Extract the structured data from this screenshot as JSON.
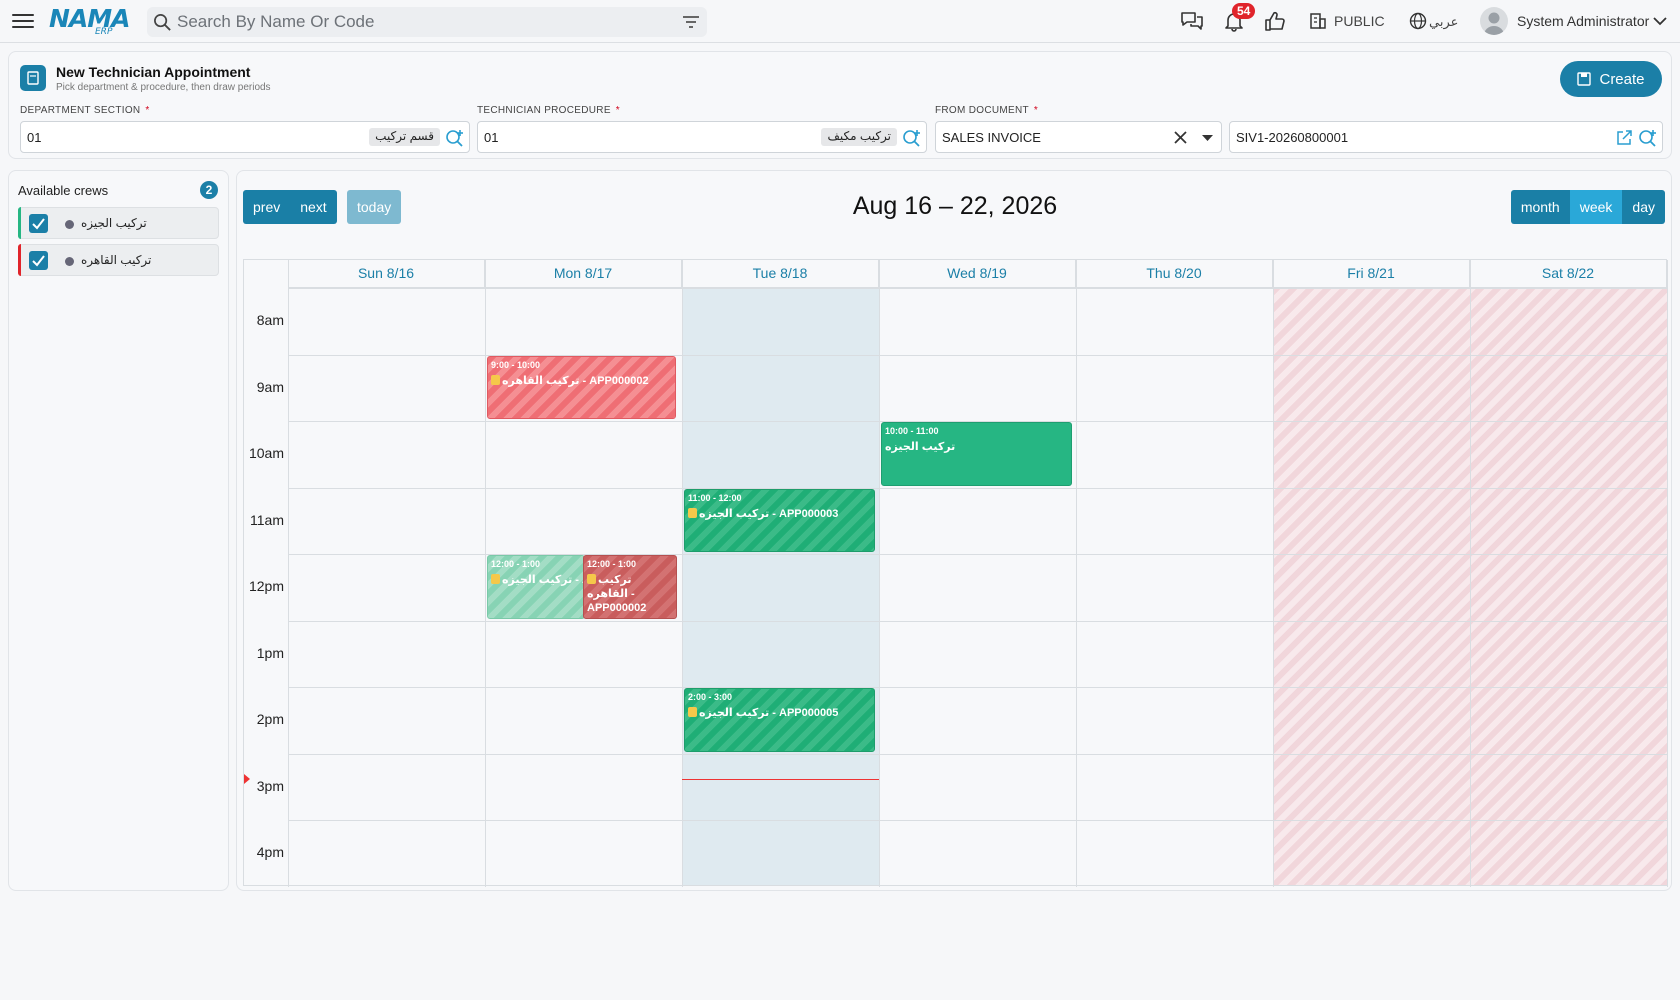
{
  "topbar": {
    "logo_main": "NAMA",
    "logo_sub": "ERP",
    "search_placeholder": "Search By Name Or Code",
    "notifications_count": "54",
    "branch": "PUBLIC",
    "language": "عربي",
    "user": "System Administrator"
  },
  "form": {
    "title": "New Technician Appointment",
    "subtitle": "Pick department & procedure, then draw periods",
    "create_label": "Create",
    "department": {
      "label": "DEPARTMENT SECTION",
      "code": "01",
      "name": "قسم تركيب"
    },
    "procedure": {
      "label": "TECHNICIAN PROCEDURE",
      "code": "01",
      "name": "تركيب مكيف"
    },
    "from_document": {
      "label": "FROM DOCUMENT",
      "type": "SALES INVOICE",
      "number": "SIV1-20260800001"
    },
    "required_mark": "*"
  },
  "sidebar": {
    "title": "Available crews",
    "count": "2",
    "crews": [
      {
        "name": "تركيب الجيزه",
        "color": "#26b683",
        "checked": true
      },
      {
        "name": "تركيب القاهره",
        "color": "#e0242b",
        "checked": true
      }
    ]
  },
  "calendar": {
    "prev": "prev",
    "next": "next",
    "today": "today",
    "title": "Aug 16 – 22, 2026",
    "views": [
      "month",
      "week",
      "day"
    ],
    "active_view": "week",
    "days": [
      "Sun 8/16",
      "Mon 8/17",
      "Tue 8/18",
      "Wed 8/19",
      "Thu 8/20",
      "Fri 8/21",
      "Sat 8/22"
    ],
    "hours": [
      "8am",
      "9am",
      "10am",
      "11am",
      "12pm",
      "1pm",
      "2pm",
      "3pm",
      "4pm"
    ],
    "events": [
      {
        "time": "9:00 - 10:00",
        "title": "تركيب القاهره - APP000002",
        "locked": true
      },
      {
        "time": "10:00 - 11:00",
        "title": "تركيب الجيزه",
        "locked": false
      },
      {
        "time": "11:00 - 12:00",
        "title": "تركيب الجيزه - APP000003",
        "locked": true
      },
      {
        "time": "12:00 - 1:00",
        "title": "تركيب الجيزه - APP000004",
        "locked": true
      },
      {
        "time": "12:00 - 1:00",
        "title": "تركيب القاهره - APP000002",
        "locked": true
      },
      {
        "time": "2:00 - 3:00",
        "title": "تركيب الجيزه - APP000005",
        "locked": true
      }
    ]
  }
}
